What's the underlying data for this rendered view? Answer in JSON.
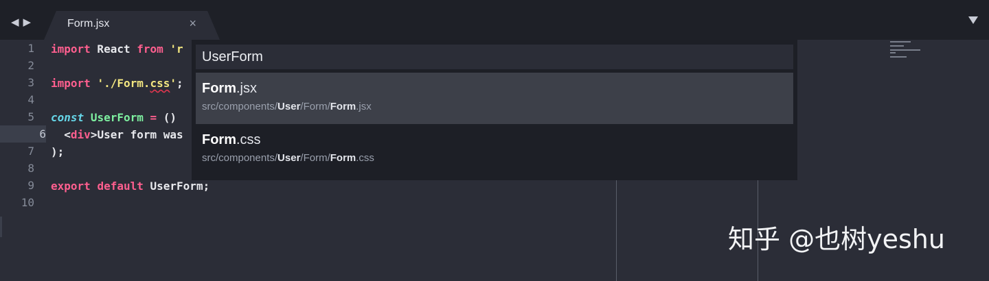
{
  "tabbar": {
    "back_glyph": "◀",
    "forward_glyph": "▶",
    "tab_title": "Form.jsx",
    "close_glyph": "×",
    "dropdown_icon": "triangle-down"
  },
  "editor": {
    "line_numbers": [
      "1",
      "2",
      "3",
      "4",
      "5",
      "6",
      "7",
      "8",
      "9",
      "10"
    ],
    "active_line": "6",
    "lines": {
      "l1": {
        "kw1": "import",
        "t1": " React ",
        "kw2": "from",
        "t2": " ",
        "str1": "'r"
      },
      "l3": {
        "kw1": "import",
        "t1": " ",
        "str1": "'./Form.",
        "str2": "css",
        "str3": "'",
        "t2": ";"
      },
      "l5": {
        "kw1": "const",
        "t1": " ",
        "fn1": "UserForm",
        "t2": " ",
        "op1": "=",
        "t3": " ()"
      },
      "l6": {
        "t1": "  <",
        "tag1": "div",
        "t2": ">User form was"
      },
      "l7": {
        "t1": ");"
      },
      "l9": {
        "kw1": "export",
        "t1": " ",
        "kw2": "default",
        "t2": " UserForm;"
      }
    }
  },
  "goto_anything": {
    "query": "UserForm",
    "results": [
      {
        "title_match": "Form",
        "title_rest": ".jsx",
        "path_1": "src/components/",
        "path_2": "User",
        "path_3": "/Form/",
        "path_4": "Form",
        "path_5": ".jsx",
        "selected": true
      },
      {
        "title_match": "Form",
        "title_rest": ".css",
        "path_1": "src/components/",
        "path_2": "User",
        "path_3": "/Form/",
        "path_4": "Form",
        "path_5": ".css",
        "selected": false
      }
    ]
  },
  "watermark": "知乎 @也树yeshu",
  "colors": {
    "background": "#2b2d37",
    "tabbar": "#1e2027",
    "keyword": "#ff5f8f",
    "string": "#f2e680",
    "function": "#7ef0a0",
    "storage": "#66d6e8",
    "selected_result": "#3d4049",
    "overlay": "#1d1f26"
  }
}
